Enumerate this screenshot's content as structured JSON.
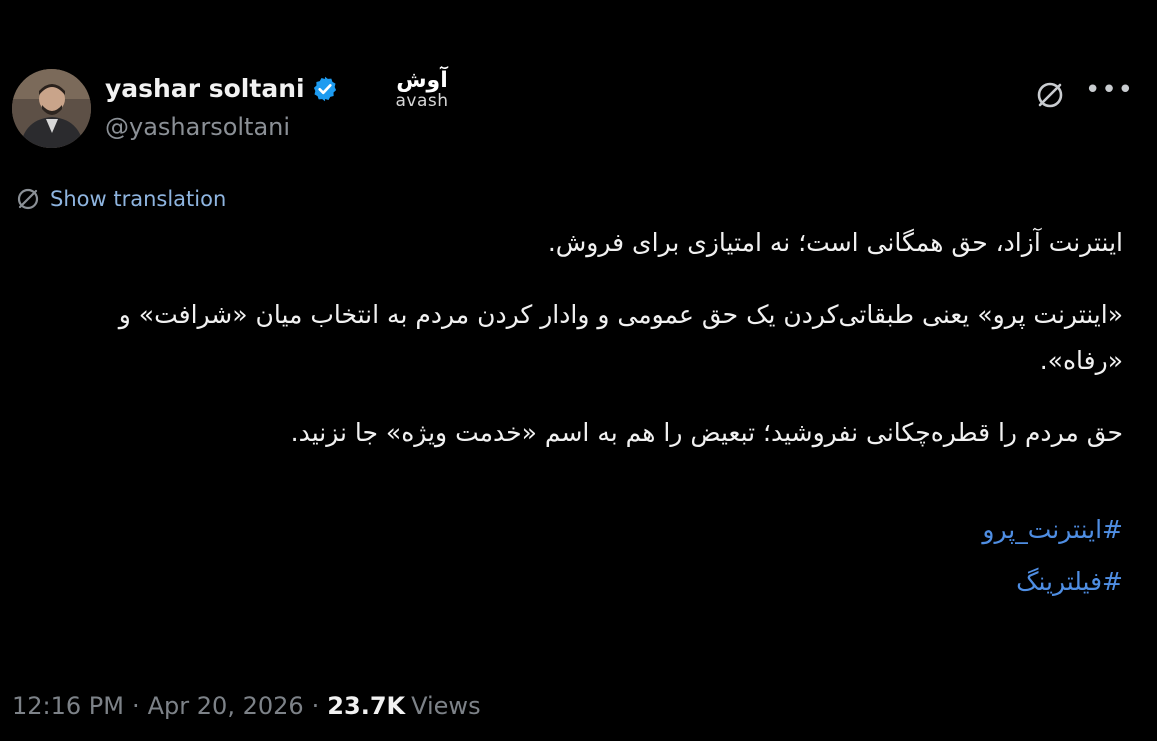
{
  "author": {
    "name": "yashar soltani",
    "handle": "@yasharsoltani",
    "verified": true
  },
  "watermark": {
    "fa": "آوش",
    "en": "avash"
  },
  "actions": {
    "translate_label": "Show translation"
  },
  "post": {
    "paragraphs": [
      "اینترنت آزاد، حق همگانی است؛ نه امتیازی برای فروش.",
      "«اینترنت پرو» یعنی طبقاتی‌کردن یک حق عمومی و وادار کردن مردم به انتخاب میان «شرافت» و «رفاه».",
      "حق مردم را قطره‌چکانی نفروشید؛ تبعیض را هم به اسم «خدمت ویژه» جا نزنید."
    ],
    "hashtags": [
      "#اینترنت_پرو",
      "#فیلترینگ"
    ]
  },
  "meta": {
    "time": "12:16 PM",
    "date": "Apr 20, 2026",
    "views_count": "23.7K",
    "views_label": "Views"
  },
  "colors": {
    "background": "#000000",
    "link": "#4f8ee3",
    "verified": "#1d9bf0",
    "muted": "#7d8288"
  },
  "icons": [
    "verified-badge-icon",
    "grok-icon",
    "more-icon",
    "translate-icon"
  ]
}
